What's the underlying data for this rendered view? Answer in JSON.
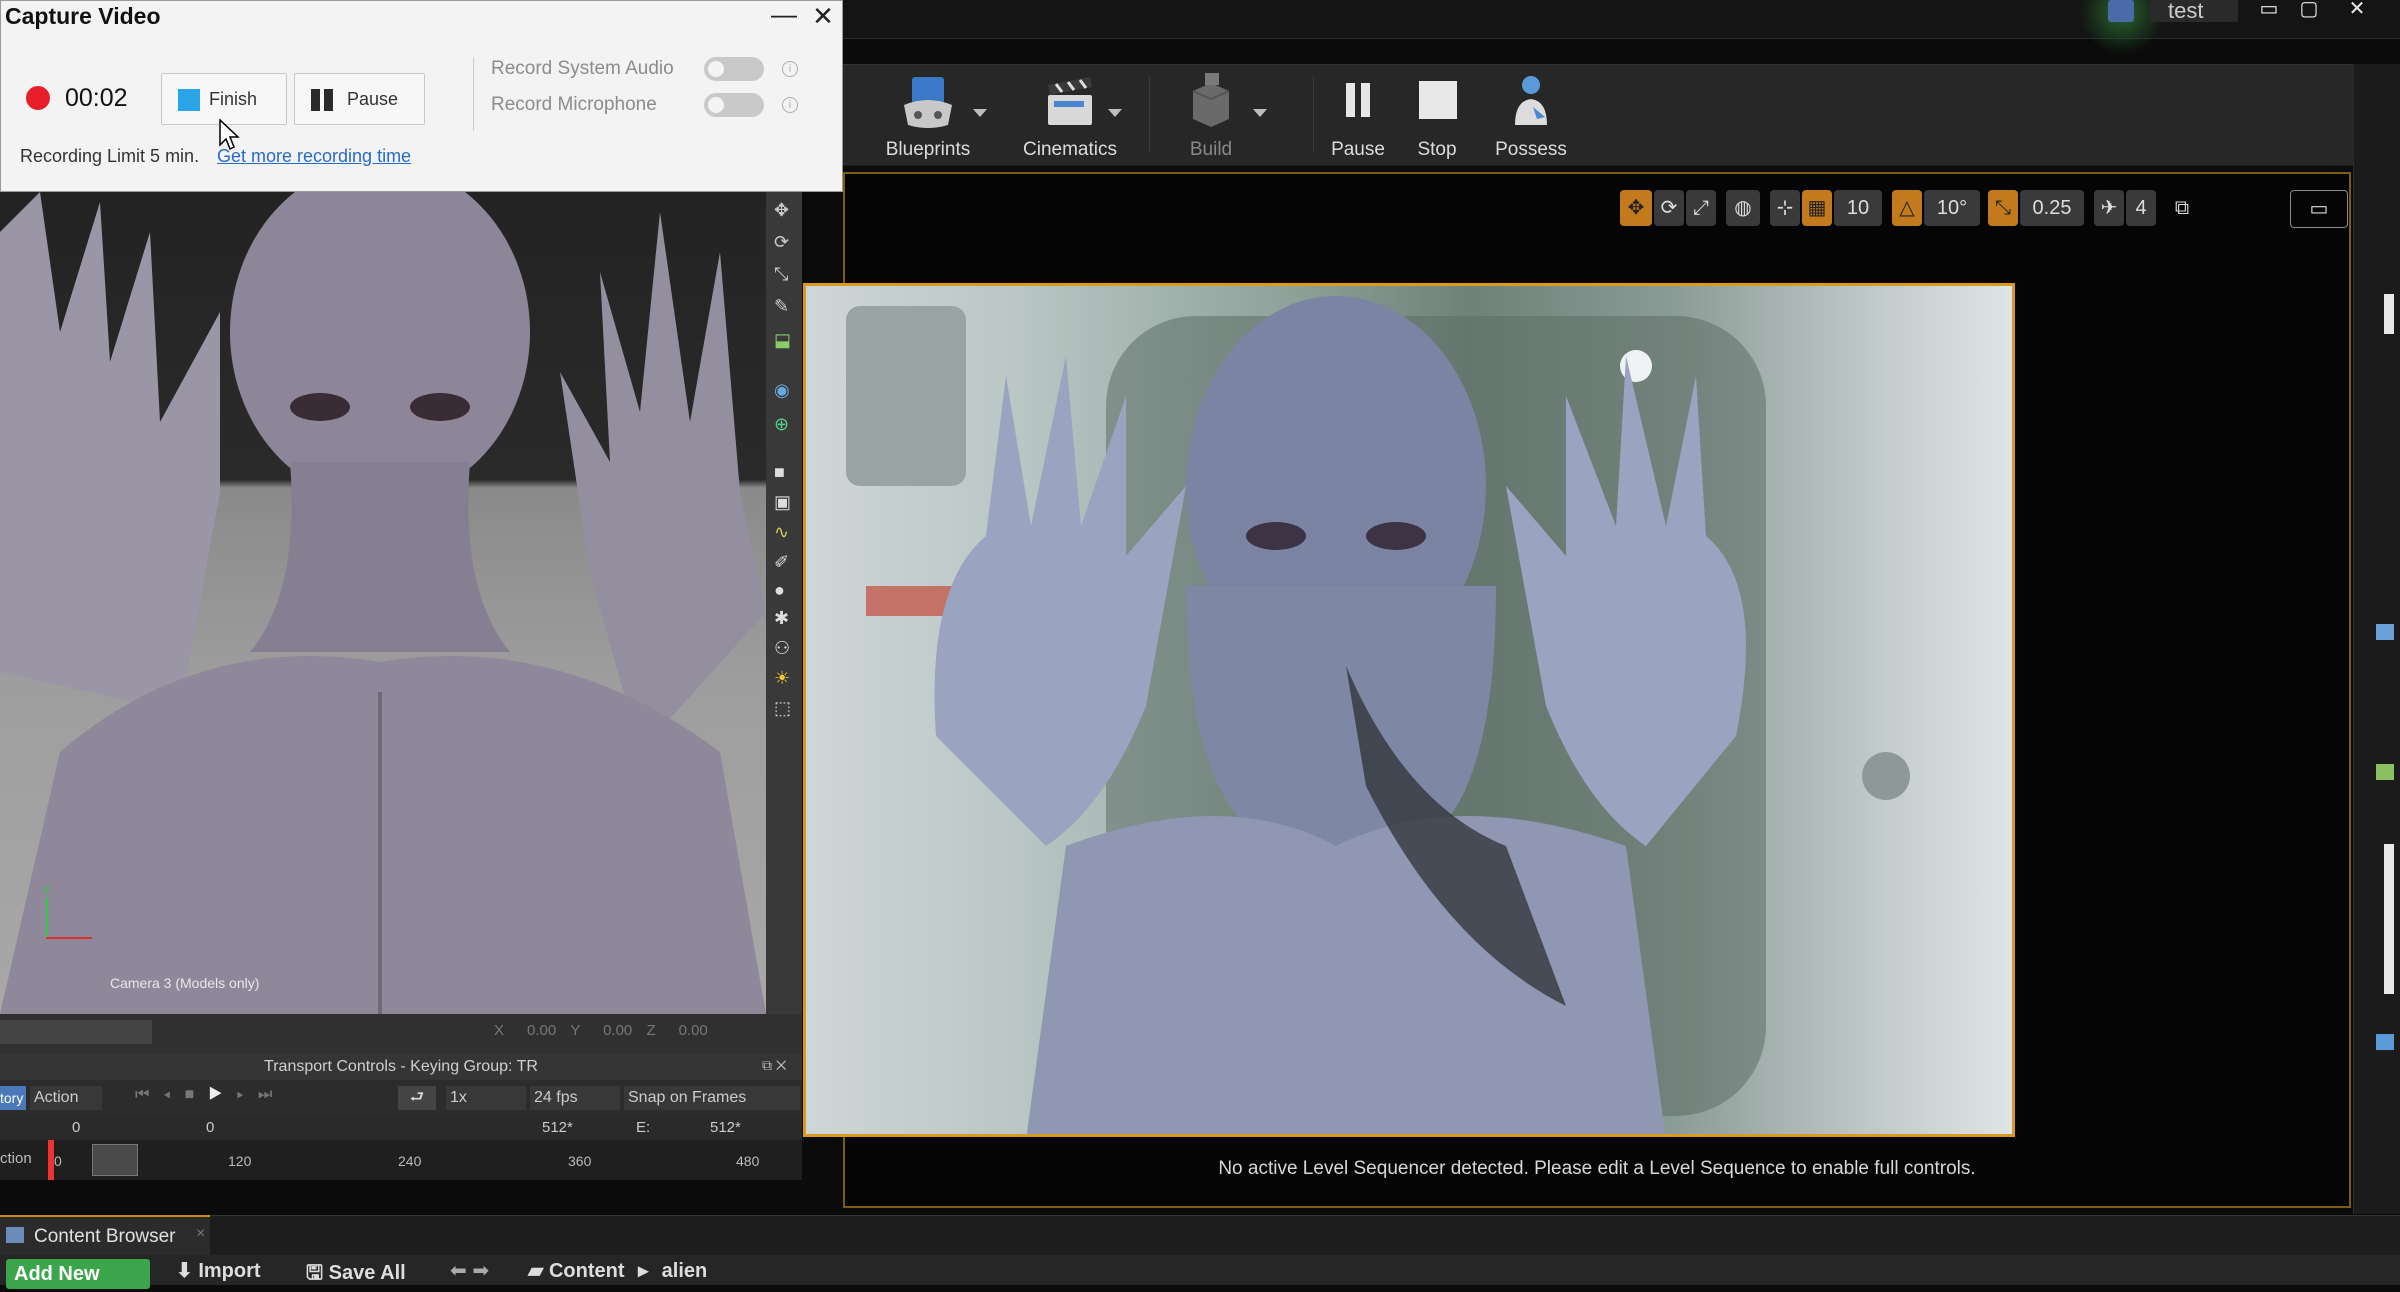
{
  "capture": {
    "title": "Capture Video",
    "timer": "00:02",
    "finish_label": "Finish",
    "pause_label": "Pause",
    "record_system_audio": "Record System Audio",
    "record_microphone": "Record Microphone",
    "limit_text": "Recording Limit 5 min.",
    "more_time_link": "Get more recording time"
  },
  "ue_window": {
    "project_name": "test"
  },
  "toolbar": {
    "items": [
      "Blueprints",
      "Cinematics",
      "Build",
      "Pause",
      "Stop",
      "Possess"
    ]
  },
  "viewport_tools": {
    "grid_value": "10",
    "rotation_value": "10°",
    "scale_value": "0.25",
    "camera_speed": "4"
  },
  "viewport": {
    "message": "No active Level Sequencer detected. Please edit a Level Sequence to enable full controls."
  },
  "content_browser": {
    "tab_label": "Content Browser",
    "add_new": "Add New",
    "import": "Import",
    "save_all": "Save All",
    "path": [
      "Content",
      "alien"
    ]
  },
  "left_app": {
    "camera_label": "Camera 3 (Models only)",
    "coords": {
      "x_label": "X",
      "x": "0.00",
      "y_label": "Y",
      "y": "0.00",
      "z_label": "Z",
      "z": "0.00"
    },
    "transport_title": "Transport Controls  -  Keying Group: TR",
    "transport": {
      "tab_left": "tory",
      "mode": "Action",
      "speed": "1x",
      "fps": "24 fps",
      "snap": "Snap on Frames"
    },
    "frames": {
      "left": "0",
      "start": "0",
      "end": "512*",
      "e_label": "E:",
      "e_value": "512*"
    },
    "timeline": {
      "label": "ction",
      "ticks": [
        "0",
        "120",
        "240",
        "360",
        "480"
      ]
    }
  },
  "colors": {
    "record_red": "#e81f2a",
    "finish_blue": "#2aa6e8",
    "ue_accent_orange": "#d99a1e",
    "add_new_green": "#3aa54a",
    "link_blue": "#2a6ac8"
  }
}
